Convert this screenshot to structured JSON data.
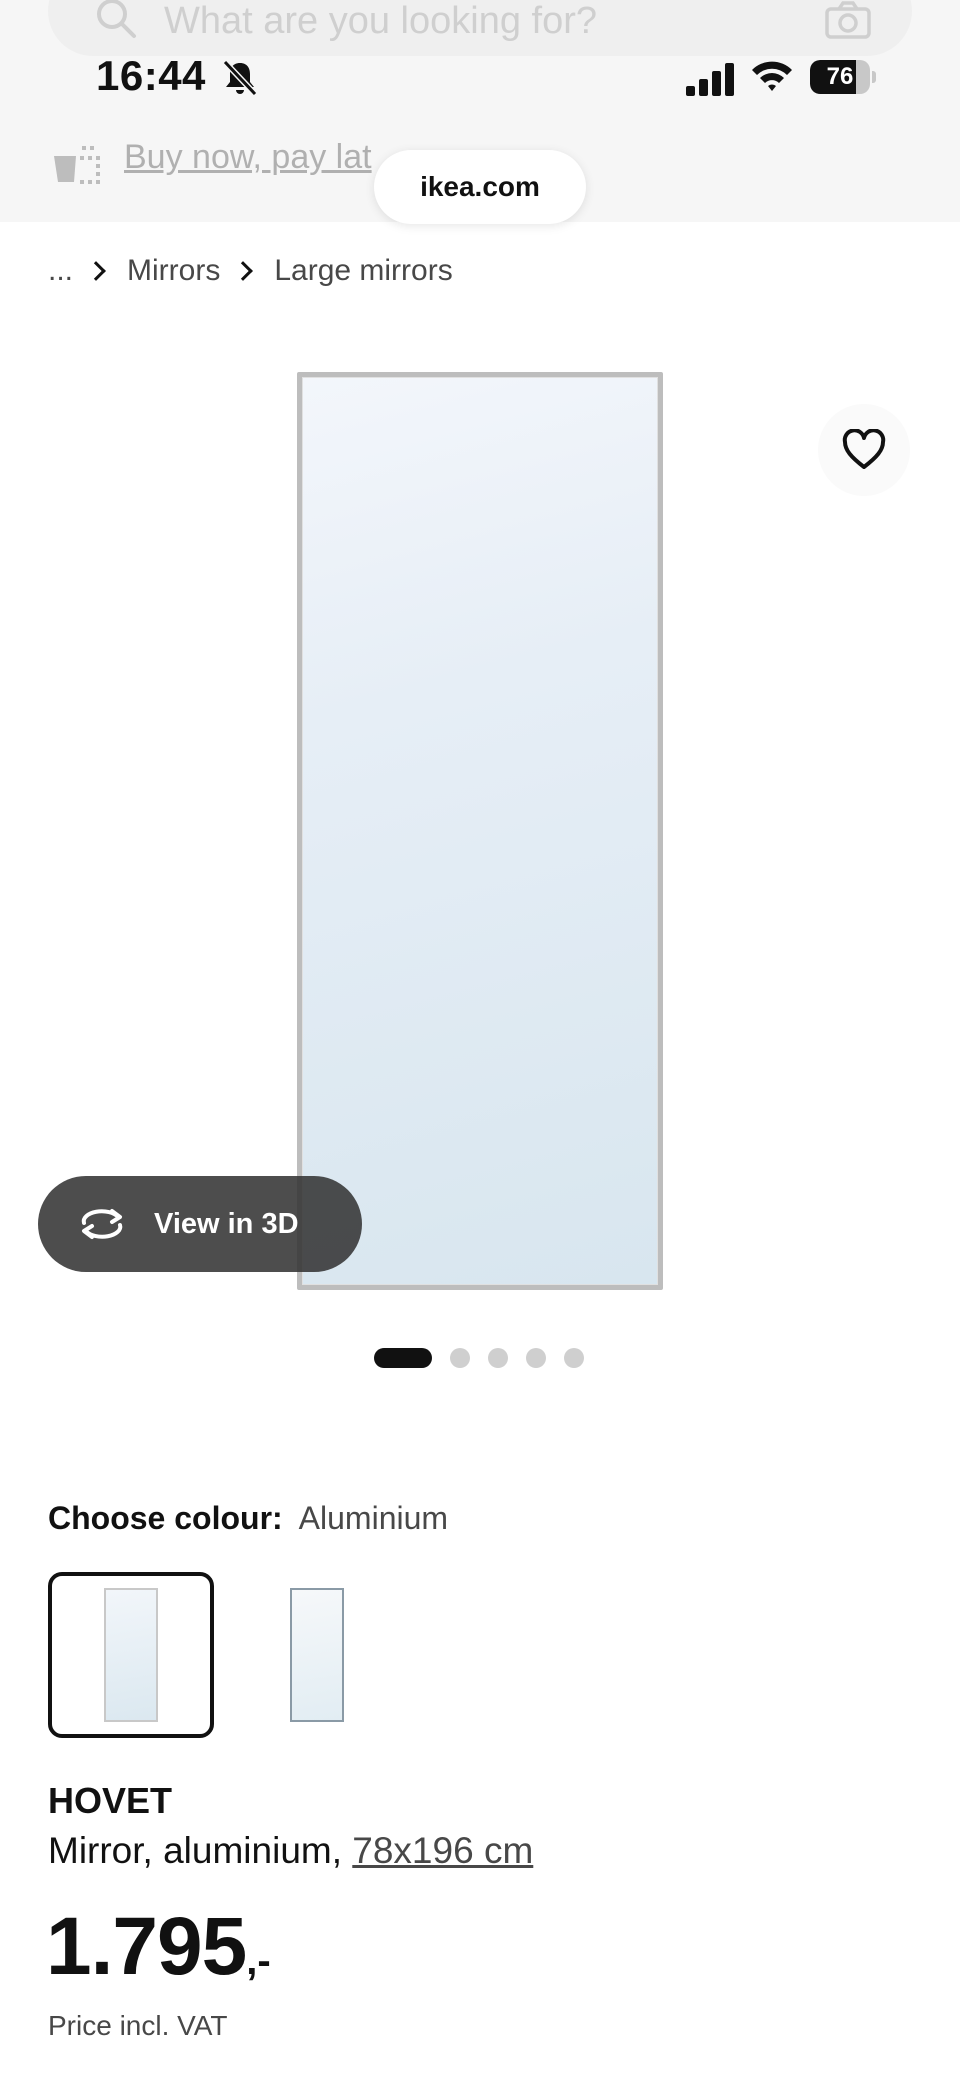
{
  "search": {
    "placeholder": "What are you looking for?"
  },
  "status_bar": {
    "time": "16:44",
    "battery_level": 76,
    "battery_label": "76"
  },
  "promo": {
    "link_text": "Buy now, pay lat"
  },
  "browser": {
    "url": "ikea.com"
  },
  "breadcrumb": {
    "ellipsis": "...",
    "items": [
      "Mirrors",
      "Large mirrors"
    ]
  },
  "gallery": {
    "view_3d_label": "View in 3D",
    "image_count": 5,
    "active_index": 0
  },
  "colour": {
    "label": "Choose colour:",
    "selected": "Aluminium"
  },
  "product": {
    "name": "HOVET",
    "description": "Mirror, aluminium, ",
    "size": "78x196 cm",
    "price": "1.795",
    "price_suffix": ",-",
    "price_note": "Price incl. VAT"
  },
  "colors": {
    "text": "#111111",
    "secondary_text": "#484848",
    "pill_bg": "#343434"
  }
}
